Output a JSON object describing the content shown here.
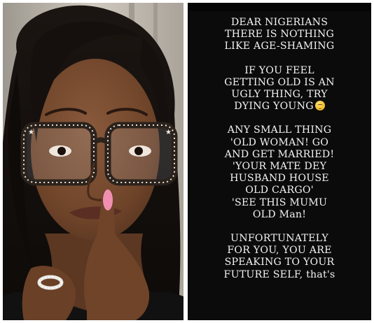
{
  "story": {
    "paragraphs": [
      {
        "lines": [
          "DEAR NIGERIANS",
          "THERE IS NOTHING",
          "LIKE AGE-SHAMING"
        ]
      },
      {
        "lines": [
          "IF YOU FEEL",
          "GETTING OLD IS AN",
          "UGLY THING, TRY",
          "DYING YOUNG"
        ],
        "emoji_after_last": "smirking-face-emoji"
      },
      {
        "lines": [
          "ANY SMALL THING",
          "'OLD WOMAN! GO",
          "AND GET MARRIED!",
          "'YOUR MATE DEY",
          "HUSBAND HOUSE",
          "OLD CARGO'",
          "'SEE THIS MUMU",
          "OLD Man!"
        ]
      },
      {
        "lines": [
          "UNFORTUNATELY",
          "FOR YOU, YOU ARE",
          "SPEAKING TO YOUR",
          "FUTURE SELF, that's"
        ]
      }
    ]
  },
  "colors": {
    "story_background": "#0b0b0b",
    "story_text": "#f2f2f2",
    "nail": "#f08fb0"
  }
}
